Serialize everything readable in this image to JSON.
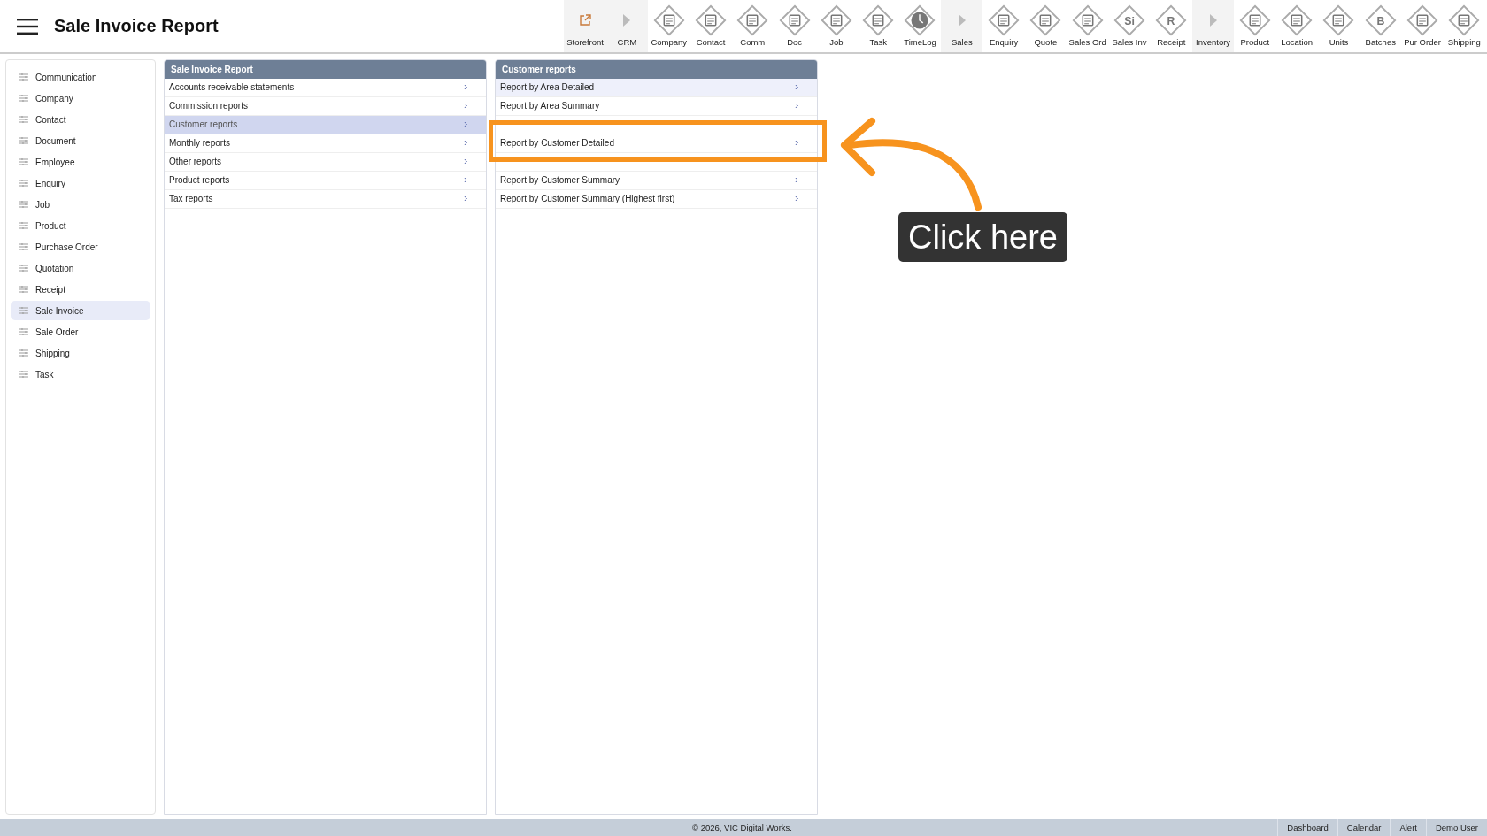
{
  "header": {
    "title": "Sale Invoice Report"
  },
  "toolbar": [
    {
      "label": "Storefront",
      "kind": "link"
    },
    {
      "label": "CRM",
      "kind": "group"
    },
    {
      "label": "Company",
      "kind": "module"
    },
    {
      "label": "Contact",
      "kind": "module"
    },
    {
      "label": "Comm",
      "kind": "module"
    },
    {
      "label": "Doc",
      "kind": "module"
    },
    {
      "label": "Job",
      "kind": "module"
    },
    {
      "label": "Task",
      "kind": "module"
    },
    {
      "label": "TimeLog",
      "kind": "clock"
    },
    {
      "label": "Sales",
      "kind": "group"
    },
    {
      "label": "Enquiry",
      "kind": "module"
    },
    {
      "label": "Quote",
      "kind": "module"
    },
    {
      "label": "Sales Ord",
      "kind": "module"
    },
    {
      "label": "Sales Inv",
      "kind": "letter",
      "glyph": "Si"
    },
    {
      "label": "Receipt",
      "kind": "letter",
      "glyph": "R"
    },
    {
      "label": "Inventory",
      "kind": "group"
    },
    {
      "label": "Product",
      "kind": "module"
    },
    {
      "label": "Location",
      "kind": "module"
    },
    {
      "label": "Units",
      "kind": "module"
    },
    {
      "label": "Batches",
      "kind": "letter",
      "glyph": "B"
    },
    {
      "label": "Pur Order",
      "kind": "module"
    },
    {
      "label": "Shipping",
      "kind": "module"
    }
  ],
  "sidebar": {
    "items": [
      {
        "label": "Communication",
        "selected": false
      },
      {
        "label": "Company",
        "selected": false
      },
      {
        "label": "Contact",
        "selected": false
      },
      {
        "label": "Document",
        "selected": false
      },
      {
        "label": "Employee",
        "selected": false
      },
      {
        "label": "Enquiry",
        "selected": false
      },
      {
        "label": "Job",
        "selected": false
      },
      {
        "label": "Product",
        "selected": false
      },
      {
        "label": "Purchase Order",
        "selected": false
      },
      {
        "label": "Quotation",
        "selected": false
      },
      {
        "label": "Receipt",
        "selected": false
      },
      {
        "label": "Sale Invoice",
        "selected": true
      },
      {
        "label": "Sale Order",
        "selected": false
      },
      {
        "label": "Shipping",
        "selected": false
      },
      {
        "label": "Task",
        "selected": false
      }
    ]
  },
  "report_menu": {
    "title": "Sale Invoice Report",
    "items": [
      {
        "label": "Accounts receivable statements",
        "selected": false
      },
      {
        "label": "Commission reports",
        "selected": false
      },
      {
        "label": "Customer reports",
        "selected": true
      },
      {
        "label": "Monthly reports",
        "selected": false
      },
      {
        "label": "Other reports",
        "selected": false
      },
      {
        "label": "Product reports",
        "selected": false
      },
      {
        "label": "Tax reports",
        "selected": false
      }
    ]
  },
  "submenu": {
    "title": "Customer reports",
    "items": [
      {
        "kind": "item",
        "label": "Report by Area Detailed",
        "selected": true
      },
      {
        "kind": "item",
        "label": "Report by Area Summary",
        "selected": false
      },
      {
        "kind": "covered"
      },
      {
        "kind": "item",
        "label": "Report by Customer Detailed",
        "selected": false
      },
      {
        "kind": "covered"
      },
      {
        "kind": "item",
        "label": "Report by Customer Summary",
        "selected": false
      },
      {
        "kind": "item",
        "label": "Report by Customer Summary (Highest first)",
        "selected": false
      }
    ]
  },
  "callout": {
    "text": "Click here"
  },
  "footer": {
    "copyright": "© 2026, VIC Digital Works.",
    "links": [
      "Dashboard",
      "Calendar",
      "Alert",
      "Demo User"
    ]
  }
}
